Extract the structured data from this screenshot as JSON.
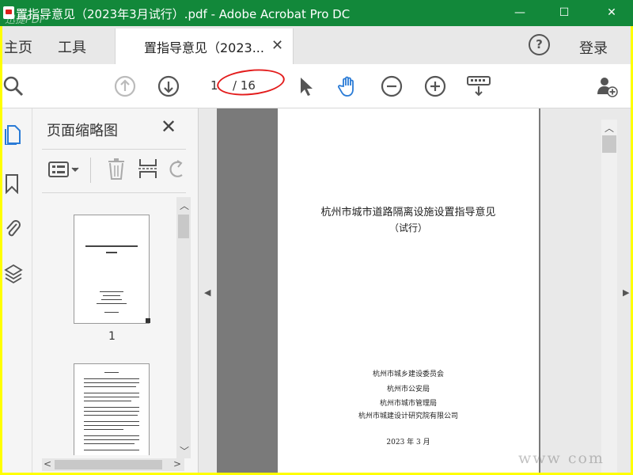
{
  "window": {
    "title": "置指导意见（2023年3月试行）.pdf - Adobe Acrobat Pro DC",
    "watermark": "迅捷PDF",
    "minimize_glyph": "—",
    "maximize_glyph": "☐",
    "close_glyph": "✕",
    "accent_color": "#12883a",
    "frame_color": "#ffff00"
  },
  "tabbar": {
    "home": "主页",
    "tools": "工具",
    "doc_tab": "置指导意见（2023...",
    "close_glyph": "✕",
    "help_glyph": "?",
    "login": "登录"
  },
  "toolbar": {
    "current_page": "1",
    "page_total": "/ 16",
    "annotation_color": "#e31c1c"
  },
  "thumbnail_panel": {
    "title": "页面缩略图",
    "close_glyph": "✕",
    "thumbnails": [
      {
        "page_label": "1"
      },
      {
        "page_label": ""
      }
    ]
  },
  "document": {
    "title": "杭州市城市道路隔离设施设置指导意见",
    "subtitle": "（试行）",
    "issuers": [
      "杭州市城乡建设委员会",
      "杭州市公安局",
      "杭州市城市管理局",
      "杭州市城建设计研究院有限公司"
    ],
    "date": "2023 年 3 月"
  },
  "footer_watermark": "www          com"
}
